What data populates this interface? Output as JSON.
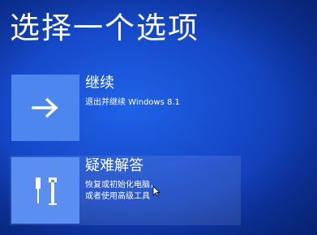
{
  "screen": {
    "title": "选择一个选项"
  },
  "options": [
    {
      "title": "继续",
      "description": "退出并继续 Windows 8.1",
      "icon": "arrow-right-icon"
    },
    {
      "title": "疑难解答",
      "description_line1": "恢复或初始化电脑，",
      "description_line2": "或者使用高级工具",
      "icon": "tools-icon"
    }
  ],
  "colors": {
    "background": "#1548c8",
    "tile": "#4d86ef",
    "text": "#ffffff"
  }
}
